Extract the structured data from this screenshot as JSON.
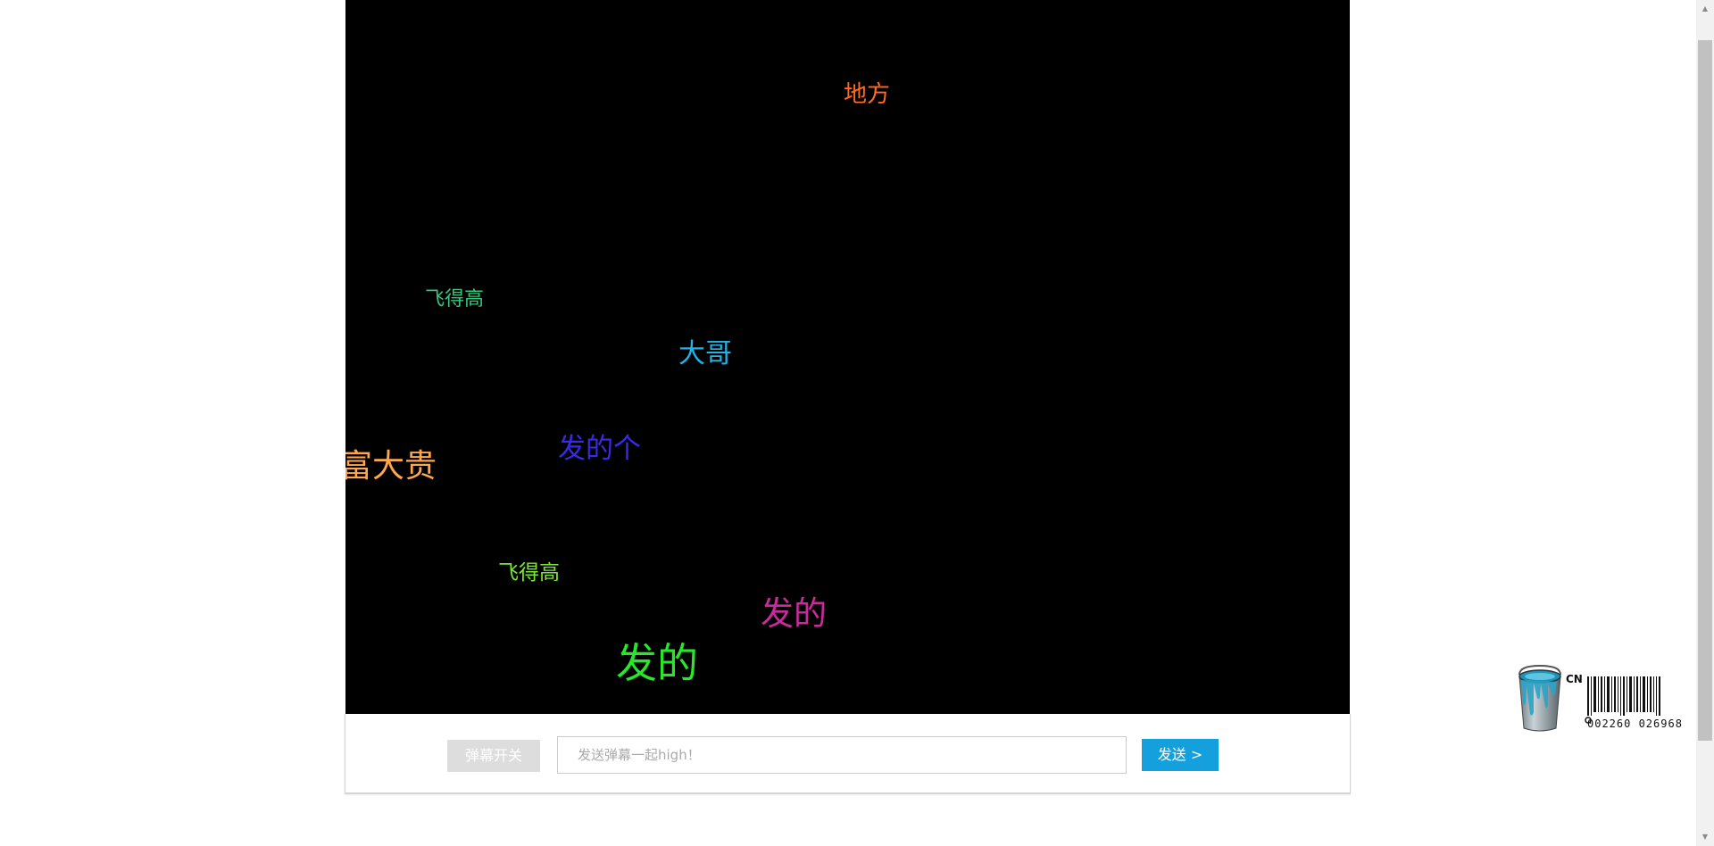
{
  "danmaku": [
    {
      "text": "地方",
      "color": "#ff6a1f"
    },
    {
      "text": "飞得高",
      "color": "#37c47a"
    },
    {
      "text": "大哥",
      "color": "#1fb3e6"
    },
    {
      "text": "发的个",
      "color": "#3b28e8"
    },
    {
      "text": "富大贵",
      "color": "#ffa74a"
    },
    {
      "text": "飞得高",
      "color": "#7ae832"
    },
    {
      "text": "发的",
      "color": "#c82c9c"
    },
    {
      "text": "发的",
      "color": "#29e62b"
    }
  ],
  "controls": {
    "toggle_label": "弹幕开关",
    "input_placeholder": "发送弹幕一起high！",
    "input_value": "",
    "send_label": "发送 >"
  },
  "widget": {
    "region_code": "CN",
    "barcode_number": "002260 026968"
  },
  "colors": {
    "screen_background": "#000000",
    "send_button": "#14a0dc",
    "toggle_button": "#dddddd"
  }
}
